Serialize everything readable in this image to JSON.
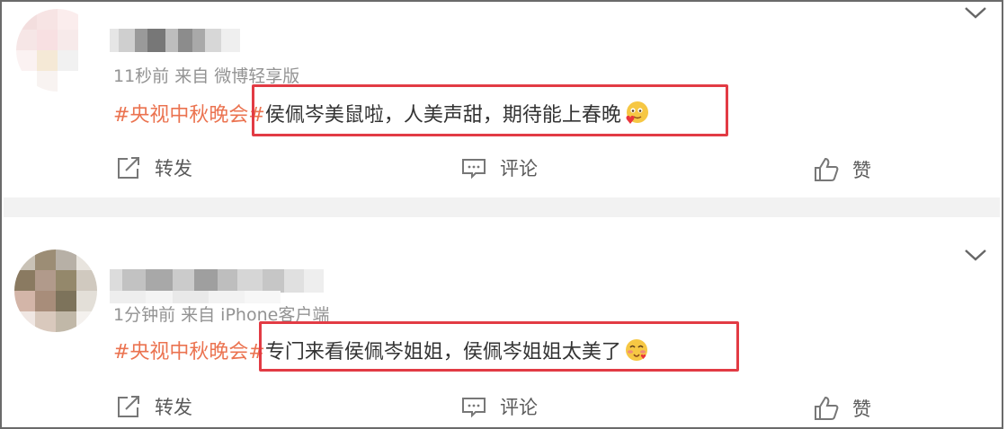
{
  "comments": [
    {
      "time": "11秒前",
      "source": "来自 微博轻享版",
      "topic": "#央视中秋晚会#",
      "text": " 侯佩岑美鼠啦，人美声甜，期待能上春晚",
      "emoji": "heart-face-emoji",
      "actions": {
        "repost": "转发",
        "comment": "评论",
        "like": "赞"
      }
    },
    {
      "time": "1分钟前",
      "source": "来自 iPhone客户端",
      "topic": "#央视中秋晚会#",
      "text": "专门来看侯佩岑姐姐，侯佩岑姐姐太美了",
      "emoji": "kiss-face-emoji",
      "actions": {
        "repost": "转发",
        "comment": "评论",
        "like": "赞"
      }
    }
  ],
  "colors": {
    "topic": "#eb7350",
    "highlight": "#e23b44",
    "meta": "#939393",
    "divider": "#f2f2f2"
  },
  "icons": [
    "chevron-down-icon",
    "repost-icon",
    "comment-icon",
    "like-icon"
  ]
}
